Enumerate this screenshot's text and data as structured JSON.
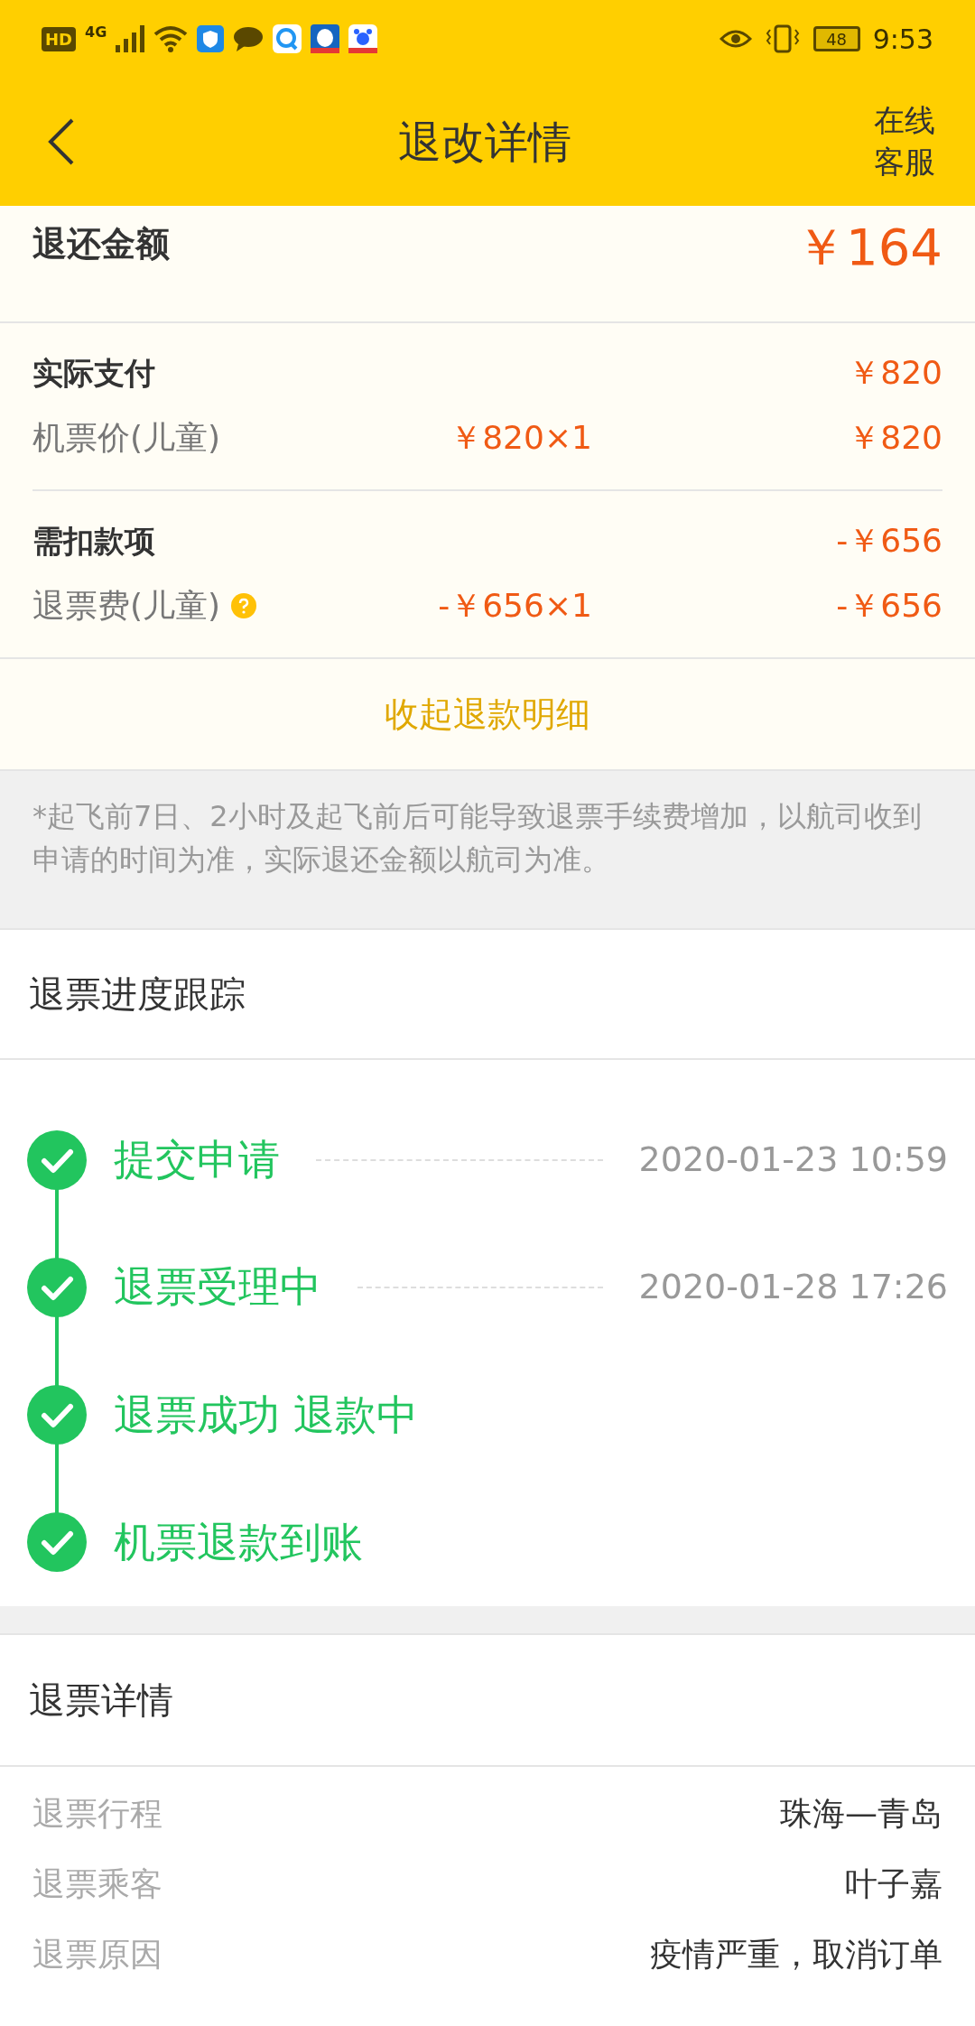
{
  "status_bar": {
    "hd": "HD",
    "network": "4G",
    "battery": "48",
    "time": "9:53"
  },
  "header": {
    "title": "退改详情",
    "service": "在线客服"
  },
  "refund_total": {
    "label": "退还金额",
    "amount": "￥164"
  },
  "sections": [
    {
      "title": "实际支付",
      "total": "￥820",
      "items": [
        {
          "label": "机票价(儿童)",
          "help": false,
          "unit": "￥820×1",
          "amount": "￥820"
        }
      ]
    },
    {
      "title": "需扣款项",
      "total": "-￥656",
      "items": [
        {
          "label": "退票费(儿童)",
          "help": true,
          "unit": "-￥656×1",
          "amount": "-￥656"
        }
      ]
    }
  ],
  "collapse_link": "收起退款明细",
  "notice": "*起飞前7日、2小时及起飞前后可能导致退票手续费增加，以航司收到申请的时间为准，实际退还金额以航司为准。",
  "progress": {
    "title": "退票进度跟踪",
    "steps": [
      {
        "label": "提交申请",
        "time": "2020-01-23 10:59",
        "done": true
      },
      {
        "label": "退票受理中",
        "time": "2020-01-28 17:26",
        "done": true
      },
      {
        "label": "退票成功 退款中",
        "done": true
      },
      {
        "label": "机票退款到账",
        "done": true
      }
    ]
  },
  "details": {
    "title": "退票详情",
    "rows": [
      {
        "label": "退票行程",
        "value": "珠海—青岛"
      },
      {
        "label": "退票乘客",
        "value": "叶子嘉"
      },
      {
        "label": "退票原因",
        "value": "疫情严重，取消订单"
      }
    ]
  }
}
